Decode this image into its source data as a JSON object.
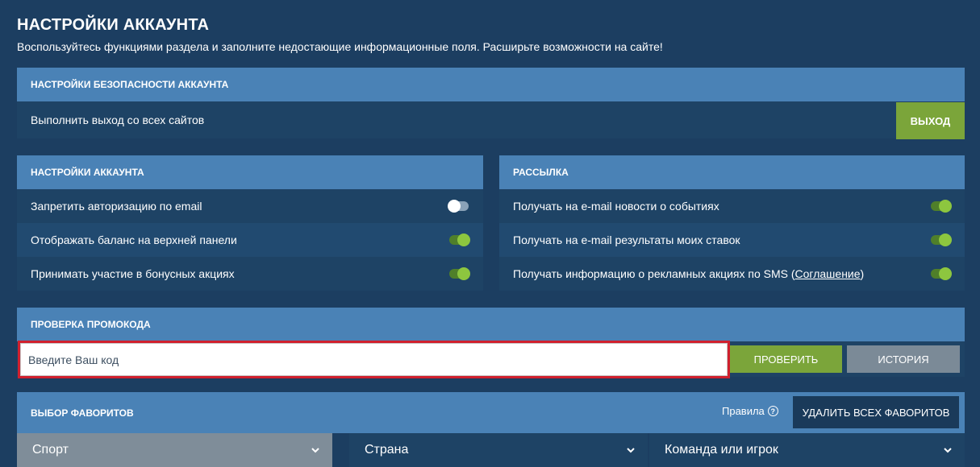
{
  "page": {
    "title": "НАСТРОЙКИ АККАУНТА",
    "subtitle": "Воспользуйтесь функциями раздела и заполните недостающие информационные поля. Расширьте возможности на сайте!"
  },
  "security": {
    "header": "НАСТРОЙКИ БЕЗОПАСНОСТИ АККАУНТА",
    "logout_all_label": "Выполнить выход со всех сайтов",
    "logout_button": "ВЫХОД"
  },
  "account_settings": {
    "header": "НАСТРОЙКИ АККАУНТА",
    "items": [
      {
        "label": "Запретить авторизацию по email",
        "enabled": false
      },
      {
        "label": "Отображать баланс на верхней панели",
        "enabled": true
      },
      {
        "label": "Принимать участие в бонусных акциях",
        "enabled": true
      }
    ]
  },
  "mailing": {
    "header": "РАССЫЛКА",
    "items": [
      {
        "label": "Получать на e-mail новости о событиях",
        "enabled": true
      },
      {
        "label": "Получать на e-mail результаты моих ставок",
        "enabled": true
      },
      {
        "label": "Получать информацию о рекламных акциях по SMS (",
        "link": "Соглашение",
        "suffix": ")",
        "enabled": true
      }
    ]
  },
  "promo": {
    "header": "ПРОВЕРКА ПРОМОКОДА",
    "input_placeholder": "Введите Ваш код",
    "check_button": "ПРОВЕРИТЬ",
    "history_button": "ИСТОРИЯ"
  },
  "favorites": {
    "header": "ВЫБОР ФАВОРИТОВ",
    "rules_label": "Правила",
    "delete_all_button": "УДАЛИТЬ ВСЕХ ФАВОРИТОВ",
    "selects": [
      "Спорт",
      "Страна",
      "Команда или игрок"
    ]
  },
  "colors": {
    "background": "#1c3e61",
    "header": "#4a82b6",
    "accent_green": "#7ba53a",
    "highlight_border": "#d0202e"
  }
}
